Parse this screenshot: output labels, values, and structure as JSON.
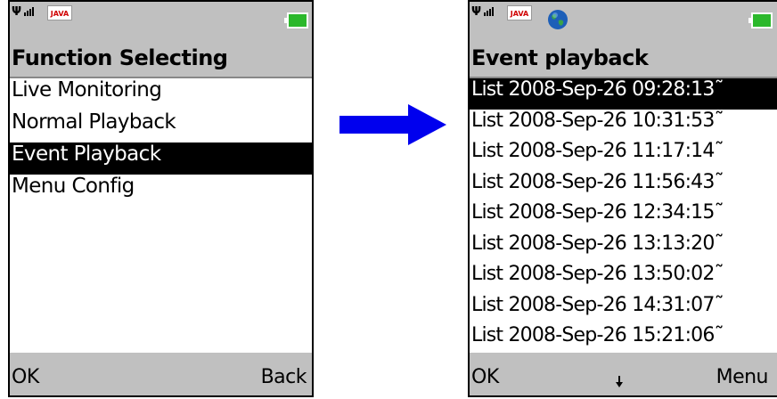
{
  "left_screen": {
    "status": {
      "java_badge": "JAVA"
    },
    "title": "Function Selecting",
    "menu_items": [
      {
        "label": "Live Monitoring",
        "selected": false
      },
      {
        "label": "Normal Playback",
        "selected": false
      },
      {
        "label": "Event Playback",
        "selected": true
      },
      {
        "label": "Menu Config",
        "selected": false
      }
    ],
    "softkeys": {
      "left": "OK",
      "right": "Back"
    }
  },
  "right_screen": {
    "status": {
      "java_badge": "JAVA"
    },
    "title": "Event playback",
    "events": [
      {
        "label": "List 2008-Sep-26 09:28:13˜",
        "selected": true
      },
      {
        "label": "List 2008-Sep-26 10:31:53˜",
        "selected": false
      },
      {
        "label": "List 2008-Sep-26 11:17:14˜",
        "selected": false
      },
      {
        "label": "List 2008-Sep-26 11:56:43˜",
        "selected": false
      },
      {
        "label": "List 2008-Sep-26 12:34:15˜",
        "selected": false
      },
      {
        "label": "List 2008-Sep-26 13:13:20˜",
        "selected": false
      },
      {
        "label": "List 2008-Sep-26 13:50:02˜",
        "selected": false
      },
      {
        "label": "List 2008-Sep-26 14:31:07˜",
        "selected": false
      },
      {
        "label": "List 2008-Sep-26 15:21:06˜",
        "selected": false
      }
    ],
    "softkeys": {
      "left": "OK",
      "right": "Menu"
    }
  },
  "colors": {
    "bar_gray": "#c0c0c0",
    "selection": "#000000",
    "arrow_blue": "#0000ee",
    "battery_green": "#2bb82b"
  }
}
